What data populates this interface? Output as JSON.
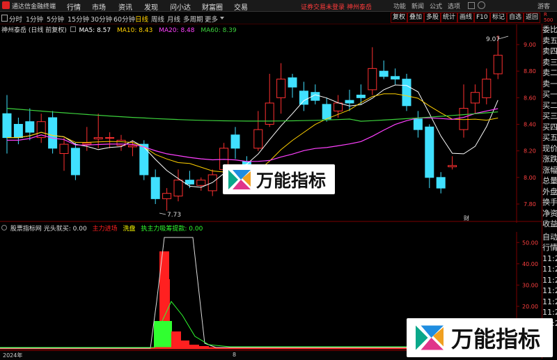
{
  "titlebar": {
    "app_name": "通达信金融终端",
    "menu": [
      "行情",
      "市场",
      "资讯",
      "发现",
      "问小达",
      "财富圈",
      "交易"
    ],
    "notice": "证券交易未登录",
    "stock_name": "神州泰岳",
    "buttons": [
      "功能",
      "新闻",
      "公式",
      "选项"
    ],
    "user": "游客"
  },
  "tabbar": {
    "periods": [
      "分时",
      "1分钟",
      "5分钟",
      "15分钟",
      "30分钟",
      "60分钟",
      "日线",
      "周线",
      "月线",
      "多周期",
      "更多"
    ],
    "active": "日线",
    "right_buttons": [
      "复权",
      "叠加",
      "多股",
      "统计",
      "画线",
      "F10",
      "标记",
      "自选",
      "返回"
    ]
  },
  "kline": {
    "title": "神州泰岳",
    "mode": "(日线 前复权)",
    "ma": [
      {
        "label": "MA5: 8.57",
        "color": "#ffffff"
      },
      {
        "label": "MA10: 8.43",
        "color": "#ffd000"
      },
      {
        "label": "MA20: 8.48",
        "color": "#ff40ff"
      },
      {
        "label": "MA60: 8.39",
        "color": "#3cd23c"
      }
    ],
    "high_mark": "9.07",
    "low_mark": "7.73",
    "y_ticks": [
      "9.00",
      "8.80",
      "8.60",
      "8.40",
      "8.20",
      "8.00",
      "7.80"
    ],
    "corner": "财"
  },
  "sub": {
    "title": "股票指标网",
    "items": [
      {
        "label": "光头就买: 0.00",
        "color": "#dddddd"
      },
      {
        "label": "主力进场",
        "color": "#ff2020"
      },
      {
        "label": "洗盘",
        "color": "#ffff00"
      },
      {
        "label": "执主力吸筹提款: 0.00",
        "color": "#30ff30"
      }
    ],
    "y_ticks": [
      "50.00",
      "40.00",
      "30.00",
      "20.00",
      "10.00"
    ]
  },
  "side_panel": [
    "委比",
    "卖五",
    "卖四",
    "卖三",
    "卖二",
    "卖一",
    "买一",
    "买二",
    "买三",
    "买四",
    "买五",
    "现价",
    "涨跌",
    "涨幅",
    "总量",
    "外盘",
    "换手",
    "净资",
    "收益"
  ],
  "side_panel2": [
    "自动",
    "行情",
    "11:2",
    "11:2",
    "11:2",
    "11:2",
    "11:2",
    "11:2",
    "11:2"
  ],
  "top_right": [
    "R",
    "500"
  ],
  "bottom_axis": {
    "year": "2024年",
    "mid": "8"
  },
  "watermark": "万能指标",
  "colors": {
    "up": "#ff3030",
    "down": "#40e0ff",
    "ma5": "#ffffff",
    "ma10": "#ffd000",
    "ma20": "#ff40ff",
    "ma60": "#3cd23c"
  }
}
